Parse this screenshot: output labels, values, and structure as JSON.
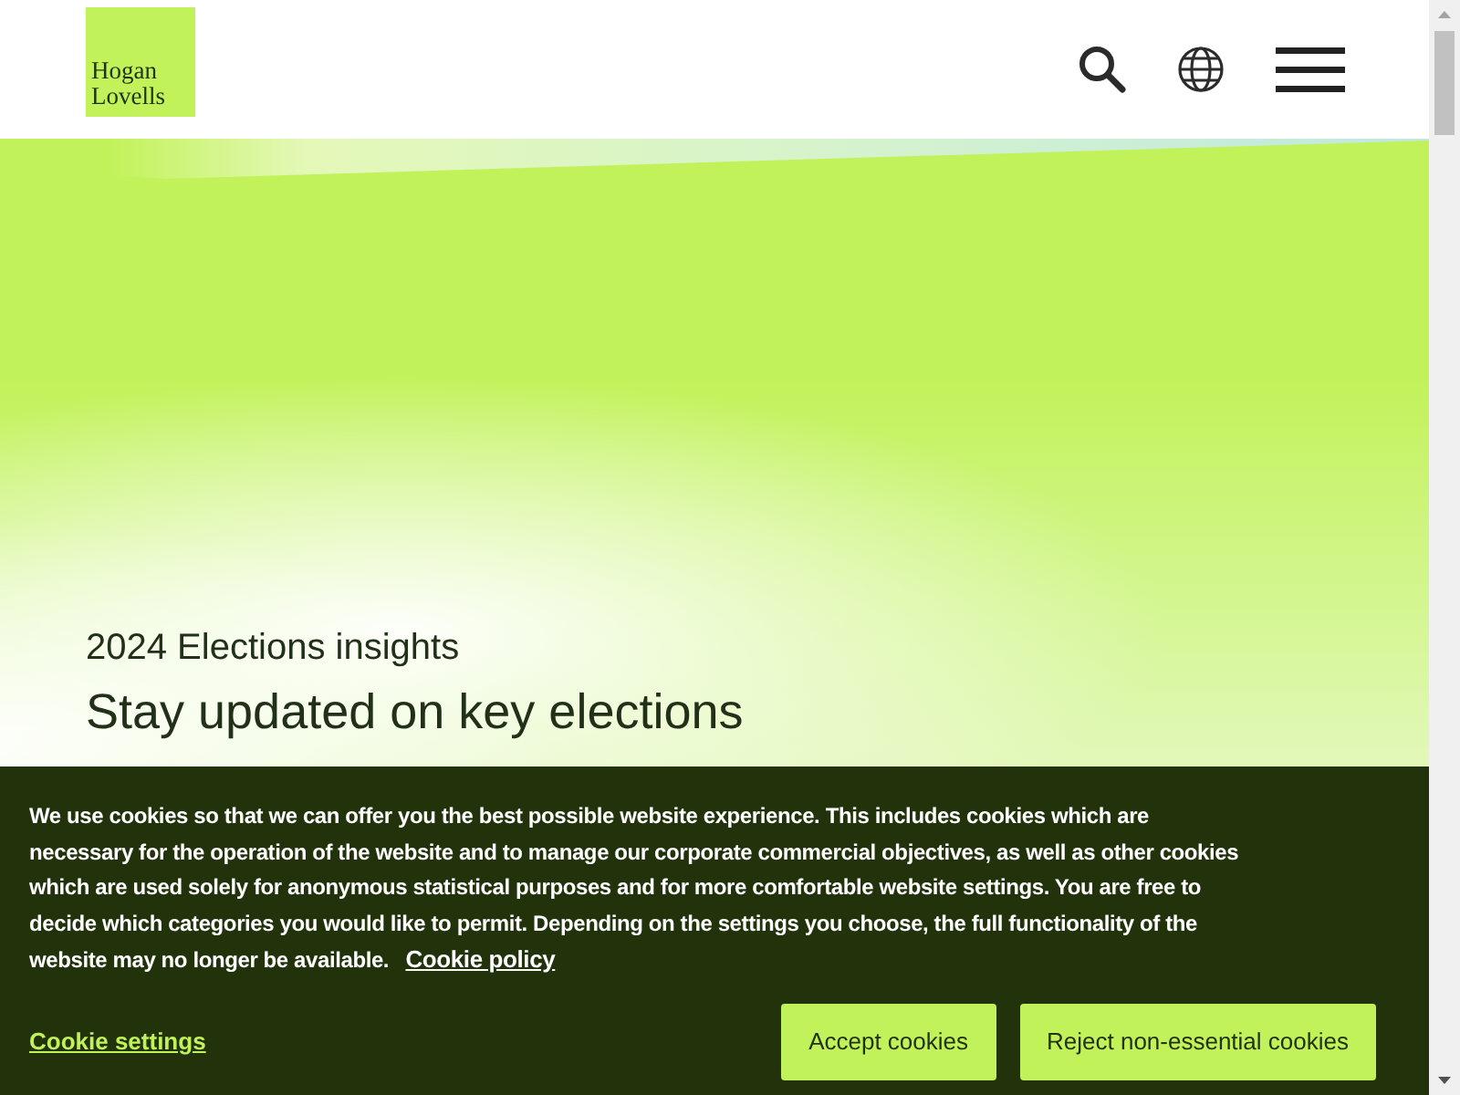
{
  "header": {
    "logo": {
      "line_1": "Hogan",
      "line_2": "Lovells"
    }
  },
  "hero": {
    "eyebrow": "2024 Elections insights",
    "heading": "Stay updated on key elections"
  },
  "cookie_banner": {
    "message": "We use cookies so that we can offer you the best possible website experience. This includes cookies which are necessary for the operation of the website and to manage our corporate commercial objectives, as well as other cookies which are used solely for anonymous statistical purposes and for more comfortable website settings. You are free to decide which categories you would like to permit. Depending on the settings you choose, the full functionality of the website may no longer be available.",
    "policy_link": "Cookie policy",
    "settings_link": "Cookie settings",
    "buttons": [
      "Accept cookies",
      "Reject non-essential cookies"
    ]
  }
}
